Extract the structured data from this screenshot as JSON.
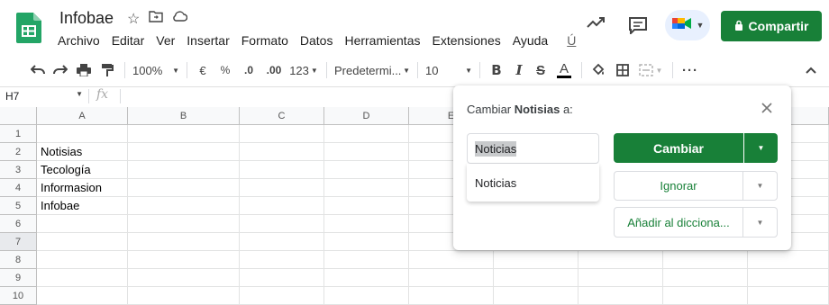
{
  "header": {
    "doc_title": "Infobae",
    "menu": [
      "Archivo",
      "Editar",
      "Ver",
      "Insertar",
      "Formato",
      "Datos",
      "Herramientas",
      "Extensiones",
      "Ayuda",
      "Ú"
    ],
    "share_label": "Compartir"
  },
  "toolbar": {
    "zoom": "100%",
    "currency": "€",
    "percent": "%",
    "dec_less": ".0",
    "dec_more": ".00",
    "number_format": "123",
    "font": "Predetermi...",
    "font_size": "10"
  },
  "formula_bar": {
    "cell_ref": "H7",
    "fx": "fx"
  },
  "sheet": {
    "columns": [
      "A",
      "B",
      "C",
      "D",
      "E"
    ],
    "rows": [
      "1",
      "2",
      "3",
      "4",
      "5",
      "6",
      "7",
      "8",
      "9",
      "10"
    ],
    "col_a_values": [
      "",
      "Notisias",
      "Tecología",
      "Informasion",
      "Infobae",
      "",
      "",
      "",
      "",
      ""
    ]
  },
  "spellcheck": {
    "title_prefix": "Cambiar ",
    "word": "Notisias",
    "title_suffix": " a:",
    "input_value": "Noticias",
    "suggestion": "Noticias",
    "change_label": "Cambiar",
    "ignore_label": "Ignorar",
    "add_label": "Añadir al dicciona..."
  }
}
